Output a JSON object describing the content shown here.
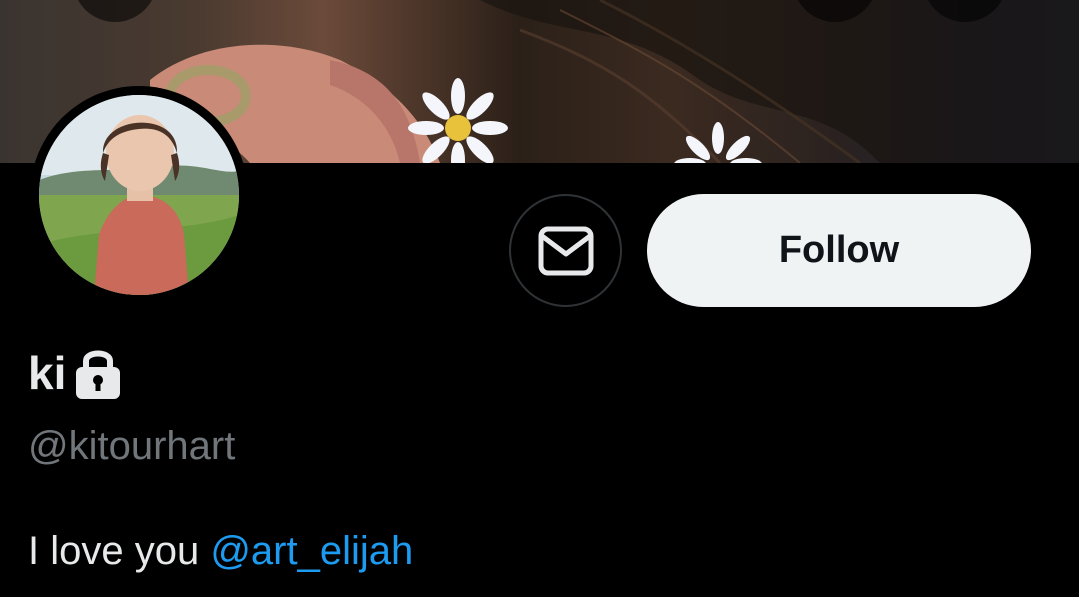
{
  "profile": {
    "display_name": "ki",
    "handle": "@kitourhart",
    "bio_text": "I love you ",
    "bio_mention": "@art_elijah",
    "protected_icon": "lock-icon"
  },
  "actions": {
    "message_icon": "envelope-icon",
    "follow_label": "Follow"
  },
  "colors": {
    "background": "#000000",
    "mention": "#1d9bf0",
    "handle": "#71767b",
    "follow_bg": "#eff3f4"
  }
}
